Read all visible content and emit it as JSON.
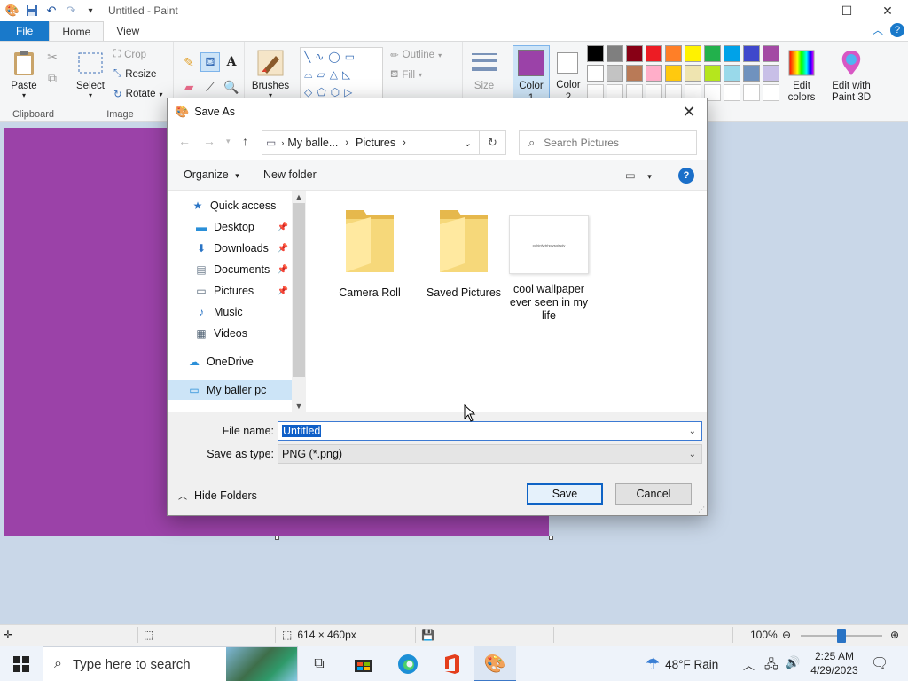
{
  "window": {
    "title": "Untitled - Paint",
    "minimize": "—",
    "maximize": "☐",
    "close": "✕"
  },
  "tabs": [
    {
      "label": "File"
    },
    {
      "label": "Home"
    },
    {
      "label": "View"
    }
  ],
  "ribbon": {
    "clipboard": {
      "paste": "Paste",
      "group": "Clipboard"
    },
    "image": {
      "select": "Select",
      "crop": "Crop",
      "resize": "Resize",
      "rotate": "Rotate",
      "group": "Image"
    },
    "brushes": "Brushes",
    "shapes": {
      "outline": "Outline",
      "fill": "Fill"
    },
    "size": "Size",
    "color1": {
      "line1": "Color",
      "line2": "1"
    },
    "color2": {
      "line1": "Color",
      "line2": "2"
    },
    "edit_colors": {
      "line1": "Edit",
      "line2": "colors"
    },
    "paint3d": {
      "line1": "Edit with",
      "line2": "Paint 3D"
    },
    "palette_row1": [
      "#000000",
      "#7f7f7f",
      "#880015",
      "#ed1c24",
      "#ff7f27",
      "#fff200",
      "#22b14c",
      "#00a2e8",
      "#3f48cc",
      "#a349a4"
    ],
    "palette_row2": [
      "#ffffff",
      "#c3c3c3",
      "#b97a57",
      "#ffaec9",
      "#ffc90e",
      "#efe4b0",
      "#b5e61d",
      "#99d9ea",
      "#7092be",
      "#c8bfe7"
    ],
    "color1_value": "#9b42a8",
    "color2_value": "#ffffff"
  },
  "canvas": {
    "color": "#9b42a8"
  },
  "status": {
    "dimensions": "614 × 460px",
    "zoom": "100%",
    "zoom_level": 0.5
  },
  "taskbar": {
    "search_placeholder": "Type here to search",
    "weather": "48°F  Rain",
    "time": "2:25 AM",
    "date": "4/29/2023"
  },
  "dialog": {
    "title": "Save As",
    "breadcrumb": [
      "My balle...",
      "Pictures"
    ],
    "search_placeholder": "Search Pictures",
    "organize": "Organize",
    "new_folder": "New folder",
    "nav_items": [
      {
        "label": "Quick access",
        "icon": "star-icon",
        "pinned": false
      },
      {
        "label": "Desktop",
        "icon": "desktop-icon",
        "pinned": true
      },
      {
        "label": "Downloads",
        "icon": "download-icon",
        "pinned": true
      },
      {
        "label": "Documents",
        "icon": "document-icon",
        "pinned": true
      },
      {
        "label": "Pictures",
        "icon": "pictures-icon",
        "pinned": true
      },
      {
        "label": "Music",
        "icon": "music-icon",
        "pinned": false
      },
      {
        "label": "Videos",
        "icon": "videos-icon",
        "pinned": false
      },
      {
        "label": "OneDrive",
        "icon": "cloud-icon",
        "pinned": false
      },
      {
        "label": "My baller pc",
        "icon": "computer-icon",
        "pinned": false
      }
    ],
    "files": [
      {
        "name": "Camera Roll",
        "type": "folder"
      },
      {
        "name": "Saved Pictures",
        "type": "folder"
      },
      {
        "name": "cool wallpaper ever seen in my life",
        "type": "image",
        "thumb_text": "pohinfvrtrhgjvsgjrsdv"
      }
    ],
    "file_name_label": "File name:",
    "file_name_value": "Untitled",
    "save_type_label": "Save as type:",
    "save_type_value": "PNG (*.png)",
    "hide_folders": "Hide Folders",
    "save": "Save",
    "cancel": "Cancel"
  }
}
